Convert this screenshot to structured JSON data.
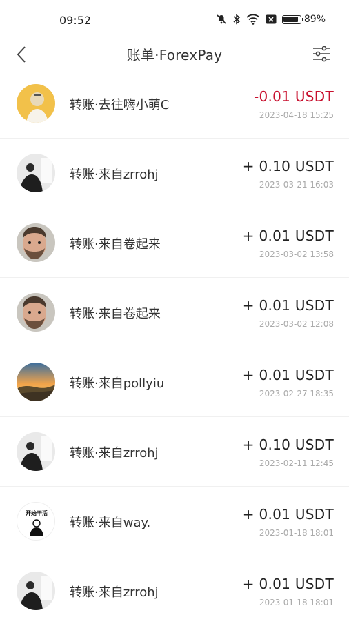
{
  "status_bar": {
    "time": "09:52",
    "battery_percent": "89%",
    "battery_level": 0.89
  },
  "nav": {
    "title": "账单·ForexPay",
    "back_icon": "chevron-left-icon",
    "filter_icon": "sliders-icon"
  },
  "colors": {
    "negative": "#c8102e",
    "date": "#aaaaaa"
  },
  "transactions": [
    {
      "title": "转账·去往嗨小萌C",
      "amount": "-0.01 USDT",
      "date": "2023-04-18 15:25",
      "avatar": "yellow-person-avatar"
    },
    {
      "title": "转账·来自zrrohj",
      "amount": "+ 0.10 USDT",
      "date": "2023-03-21 16:03",
      "avatar": "man-in-suit-avatar"
    },
    {
      "title": "转账·来自卷起来",
      "amount": "+ 0.01 USDT",
      "date": "2023-03-02 13:58",
      "avatar": "bearded-man-avatar"
    },
    {
      "title": "转账·来自卷起来",
      "amount": "+ 0.01 USDT",
      "date": "2023-03-02 12:08",
      "avatar": "bearded-man-avatar"
    },
    {
      "title": "转账·来自pollyiu",
      "amount": "+ 0.01 USDT",
      "date": "2023-02-27 18:35",
      "avatar": "sunset-landscape-avatar"
    },
    {
      "title": "转账·来自zrrohj",
      "amount": "+ 0.10 USDT",
      "date": "2023-02-11 12:45",
      "avatar": "man-in-suit-avatar"
    },
    {
      "title": "转账·来自way.",
      "amount": "+ 0.01 USDT",
      "date": "2023-01-18 18:01",
      "avatar": "text-figure-avatar",
      "avatar_text": "开始干活"
    },
    {
      "title": "转账·来自zrrohj",
      "amount": "+ 0.01 USDT",
      "date": "2023-01-18 18:01",
      "avatar": "man-in-suit-avatar"
    }
  ]
}
